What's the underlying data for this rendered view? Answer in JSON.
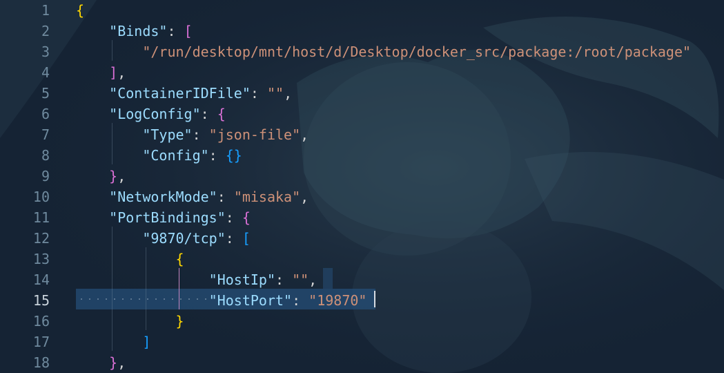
{
  "editor": {
    "active_line": 15,
    "lines": [
      {
        "n": "1",
        "segs": [
          {
            "t": "{",
            "c": "b1"
          }
        ]
      },
      {
        "n": "2",
        "segs": [
          {
            "t": "    ",
            "c": "p"
          },
          {
            "t": "\"Binds\"",
            "c": "k"
          },
          {
            "t": ": ",
            "c": "p"
          },
          {
            "t": "[",
            "c": "b2"
          }
        ]
      },
      {
        "n": "3",
        "segs": [
          {
            "t": "        ",
            "c": "p"
          },
          {
            "t": "\"/run/desktop/mnt/host/d/Desktop/docker_src/package:/root/package\"",
            "c": "s"
          }
        ]
      },
      {
        "n": "4",
        "segs": [
          {
            "t": "    ",
            "c": "p"
          },
          {
            "t": "]",
            "c": "b2"
          },
          {
            "t": ",",
            "c": "p"
          }
        ]
      },
      {
        "n": "5",
        "segs": [
          {
            "t": "    ",
            "c": "p"
          },
          {
            "t": "\"ContainerIDFile\"",
            "c": "k"
          },
          {
            "t": ": ",
            "c": "p"
          },
          {
            "t": "\"\"",
            "c": "s"
          },
          {
            "t": ",",
            "c": "p"
          }
        ]
      },
      {
        "n": "6",
        "segs": [
          {
            "t": "    ",
            "c": "p"
          },
          {
            "t": "\"LogConfig\"",
            "c": "k"
          },
          {
            "t": ": ",
            "c": "p"
          },
          {
            "t": "{",
            "c": "b2"
          }
        ]
      },
      {
        "n": "7",
        "segs": [
          {
            "t": "        ",
            "c": "p"
          },
          {
            "t": "\"Type\"",
            "c": "k"
          },
          {
            "t": ": ",
            "c": "p"
          },
          {
            "t": "\"json-file\"",
            "c": "s"
          },
          {
            "t": ",",
            "c": "p"
          }
        ]
      },
      {
        "n": "8",
        "segs": [
          {
            "t": "        ",
            "c": "p"
          },
          {
            "t": "\"Config\"",
            "c": "k"
          },
          {
            "t": ": ",
            "c": "p"
          },
          {
            "t": "{}",
            "c": "b3"
          }
        ]
      },
      {
        "n": "9",
        "segs": [
          {
            "t": "    ",
            "c": "p"
          },
          {
            "t": "}",
            "c": "b2"
          },
          {
            "t": ",",
            "c": "p"
          }
        ]
      },
      {
        "n": "10",
        "segs": [
          {
            "t": "    ",
            "c": "p"
          },
          {
            "t": "\"NetworkMode\"",
            "c": "k"
          },
          {
            "t": ": ",
            "c": "p"
          },
          {
            "t": "\"misaka\"",
            "c": "s"
          },
          {
            "t": ",",
            "c": "p"
          }
        ]
      },
      {
        "n": "11",
        "segs": [
          {
            "t": "    ",
            "c": "p"
          },
          {
            "t": "\"PortBindings\"",
            "c": "k"
          },
          {
            "t": ": ",
            "c": "p"
          },
          {
            "t": "{",
            "c": "b2"
          }
        ]
      },
      {
        "n": "12",
        "segs": [
          {
            "t": "        ",
            "c": "p"
          },
          {
            "t": "\"9870/tcp\"",
            "c": "k"
          },
          {
            "t": ": ",
            "c": "p"
          },
          {
            "t": "[",
            "c": "b3"
          }
        ]
      },
      {
        "n": "13",
        "segs": [
          {
            "t": "            ",
            "c": "p"
          },
          {
            "t": "{",
            "c": "b1"
          }
        ]
      },
      {
        "n": "14",
        "segs": [
          {
            "t": "                ",
            "c": "p"
          },
          {
            "t": "\"HostIp\"",
            "c": "k"
          },
          {
            "t": ": ",
            "c": "p"
          },
          {
            "t": "\"\"",
            "c": "s"
          },
          {
            "t": ",",
            "c": "p"
          }
        ]
      },
      {
        "n": "15",
        "segs": [
          {
            "t": "                ",
            "c": "p"
          },
          {
            "t": "\"HostPort\"",
            "c": "k"
          },
          {
            "t": ": ",
            "c": "p"
          },
          {
            "t": "\"19870\"",
            "c": "s"
          }
        ]
      },
      {
        "n": "16",
        "segs": [
          {
            "t": "            ",
            "c": "p"
          },
          {
            "t": "}",
            "c": "b1"
          }
        ]
      },
      {
        "n": "17",
        "segs": [
          {
            "t": "        ",
            "c": "p"
          },
          {
            "t": "]",
            "c": "b3"
          }
        ]
      },
      {
        "n": "18",
        "segs": [
          {
            "t": "    ",
            "c": "p"
          },
          {
            "t": "}",
            "c": "b2"
          },
          {
            "t": ",",
            "c": "p"
          }
        ]
      }
    ]
  }
}
